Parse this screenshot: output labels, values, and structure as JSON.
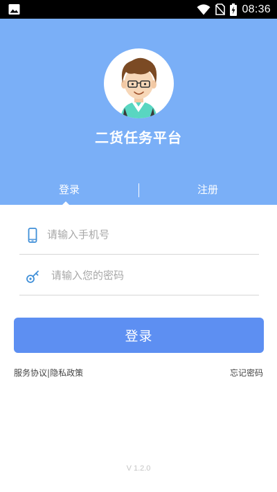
{
  "status_bar": {
    "time": "08:36",
    "icons": [
      "image-icon",
      "wifi-icon",
      "no-sim-icon",
      "battery-charging-icon"
    ]
  },
  "header": {
    "app_title": "二货任务平台",
    "avatar_icon": "avatar-boy-glasses"
  },
  "tabs": [
    {
      "label": "登录",
      "selected": true
    },
    {
      "label": "注册",
      "selected": false
    }
  ],
  "form": {
    "phone": {
      "placeholder": "请输入手机号",
      "value": "",
      "icon": "phone-icon"
    },
    "password": {
      "placeholder": "请输入您的密码",
      "value": "",
      "icon": "key-icon"
    },
    "submit_label": "登录"
  },
  "footer_links": {
    "service_agreement": "服务协议",
    "separator": "|",
    "privacy_policy": "隐私政策",
    "forgot_password": "忘记密码"
  },
  "version": "V 1.2.0",
  "colors": {
    "header_bg": "#7aaff7",
    "button_bg": "#5d8ff2",
    "icon_color": "#3f8fd8",
    "status_bar_bg": "#000000"
  }
}
